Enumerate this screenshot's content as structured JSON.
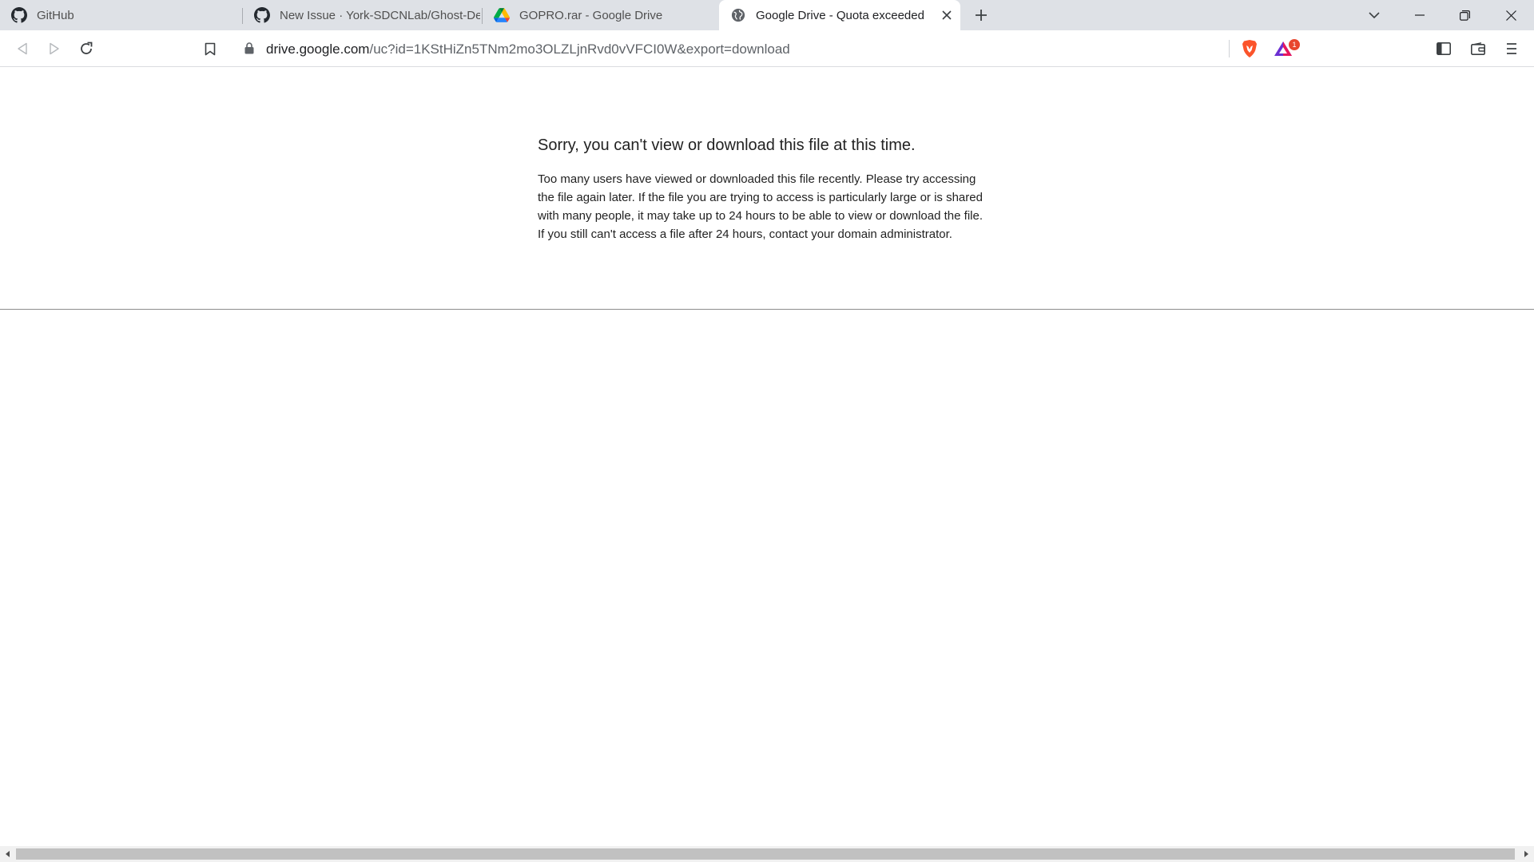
{
  "browser": {
    "tabs": [
      {
        "label": "GitHub",
        "icon": "github-icon",
        "active": false
      },
      {
        "label": "New Issue · York-SDCNLab/Ghost-Deb",
        "icon": "github-icon",
        "active": false
      },
      {
        "label": "GOPRO.rar - Google Drive",
        "icon": "google-drive-icon",
        "active": false
      },
      {
        "label": "Google Drive - Quota exceeded",
        "icon": "globe-icon",
        "active": true
      }
    ],
    "url_host": "drive.google.com",
    "url_path": "/uc?id=1KStHiZn5TNm2mo3OLZLjnRvd0vVFCI0W&export=download",
    "rewards_badge_count": "1",
    "colors": {
      "tabstrip_bg": "#dee1e6",
      "brave_orange": "#fb542b",
      "rewards_purple": "#6b2fd2"
    }
  },
  "page": {
    "heading": "Sorry, you can't view or download this file at this time.",
    "body": "Too many users have viewed or downloaded this file recently. Please try accessing the file again later. If the file you are trying to access is particularly large or is shared with many people, it may take up to 24 hours to be able to view or download the file. If you still can't access a file after 24 hours, contact your domain administrator."
  }
}
